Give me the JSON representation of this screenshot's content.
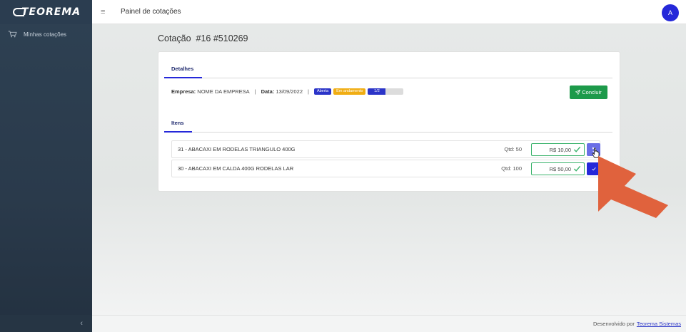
{
  "brand": {
    "name": "TEOREMA"
  },
  "sidebar": {
    "items": [
      {
        "label": "Minhas cotações",
        "icon": "cart-icon"
      }
    ],
    "collapse_icon": "‹"
  },
  "topbar": {
    "menu_icon": "≡",
    "title": "Painel de cotações",
    "avatar_letter": "A"
  },
  "page": {
    "title": "Cotação  #16 #510269"
  },
  "tabs": {
    "details": "Detalhes",
    "items": "Itens"
  },
  "details": {
    "empresa_label": "Empresa:",
    "empresa_value": "NOME DA EMPRESA",
    "data_label": "Data:",
    "data_value": "13/09/2022",
    "separator": "|",
    "badges": {
      "status": "Aberta",
      "progress_state": "Em andamento"
    },
    "progress": {
      "label": "1/2",
      "fraction": 0.5
    },
    "conclude_button": "Concluir"
  },
  "items": [
    {
      "name": "31 - ABACAXI EM RODELAS TRIANGULO 400G",
      "qtd": "Qtd: 50",
      "price": "R$ 10,00"
    },
    {
      "name": "30 - ABACAXI EM CALDA 400G RODELAS LAR",
      "qtd": "Qtd: 100",
      "price": "R$ 50,00"
    }
  ],
  "footer": {
    "prefix": "Desenvolvido por",
    "link": "Teorema Sistemas"
  },
  "colors": {
    "primary": "#2528d9",
    "success": "#1d9a4a",
    "warning": "#f0ad13",
    "sidebar": "#2e4153",
    "annotation_arrow": "#e0623d"
  }
}
